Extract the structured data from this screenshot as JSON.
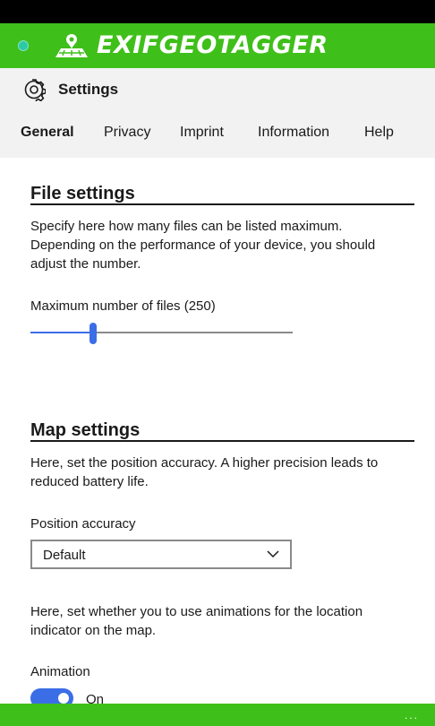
{
  "app": {
    "name": "EXIFGEOTAGGER",
    "accent_color": "#3fbf1a",
    "slider_color": "#3b6ee6"
  },
  "header": {
    "title": "Settings",
    "icon": "gear-icon"
  },
  "tabs": [
    {
      "label": "General",
      "active": true
    },
    {
      "label": "Privacy",
      "active": false
    },
    {
      "label": "Imprint",
      "active": false
    },
    {
      "label": "Information",
      "active": false
    },
    {
      "label": "Help",
      "active": false
    }
  ],
  "file_settings": {
    "title": "File settings",
    "description": "Specify here how many files can be listed maximum. Depending on the performance of your device, you should adjust the number.",
    "max_files_label": "Maximum number of files (250)",
    "max_files_fraction": 0.24
  },
  "map_settings": {
    "title": "Map settings",
    "accuracy_description": "Here, set the position accuracy. A higher precision leads to reduced battery life.",
    "accuracy_label": "Position accuracy",
    "accuracy_value": "Default",
    "animation_description": "Here, set whether you to use animations for the location indicator on the map.",
    "animation_label": "Animation",
    "animation_state": "On",
    "animation_on": true
  },
  "bottom_bar": {
    "more_label": "..."
  }
}
